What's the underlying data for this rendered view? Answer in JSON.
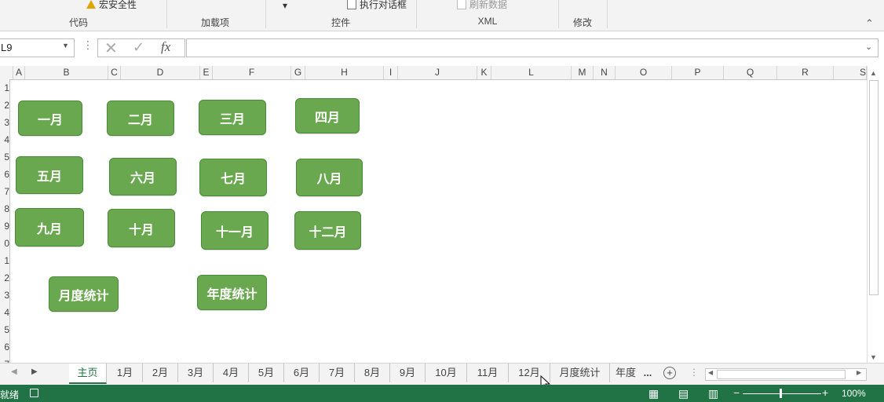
{
  "ribbon": {
    "groups": [
      "代码",
      "加载项",
      "控件",
      "XML",
      "修改"
    ],
    "macro_security": "宏安全性",
    "run_dialog": "执行对话框",
    "refresh_data": "刷新数据",
    "collapse_icon": "chevron-up-icon"
  },
  "formula_bar": {
    "name_box": "L9",
    "fx": "fx",
    "formula": ""
  },
  "columns": [
    "A",
    "B",
    "C",
    "D",
    "E",
    "F",
    "G",
    "H",
    "I",
    "J",
    "K",
    "L",
    "M",
    "N",
    "O",
    "P",
    "Q",
    "R",
    "S"
  ],
  "rows": [
    "1",
    "2",
    "3",
    "4",
    "5",
    "6",
    "7",
    "8",
    "9",
    "0",
    "1",
    "2",
    "3",
    "4",
    "5",
    "6",
    "7"
  ],
  "buttons": {
    "jan": "一月",
    "feb": "二月",
    "mar": "三月",
    "apr": "四月",
    "may": "五月",
    "jun": "六月",
    "jul": "七月",
    "aug": "八月",
    "sep": "九月",
    "oct": "十月",
    "nov": "十一月",
    "dec": "十二月",
    "monthly": "月度统计",
    "yearly": "年度统计"
  },
  "sheet_tabs": [
    "主页",
    "1月",
    "2月",
    "3月",
    "4月",
    "5月",
    "6月",
    "7月",
    "8月",
    "9月",
    "10月",
    "11月",
    "12月",
    "月度统计",
    "年度"
  ],
  "more_tabs": "...",
  "status": {
    "ready": "就绪",
    "zoom": "100%"
  }
}
